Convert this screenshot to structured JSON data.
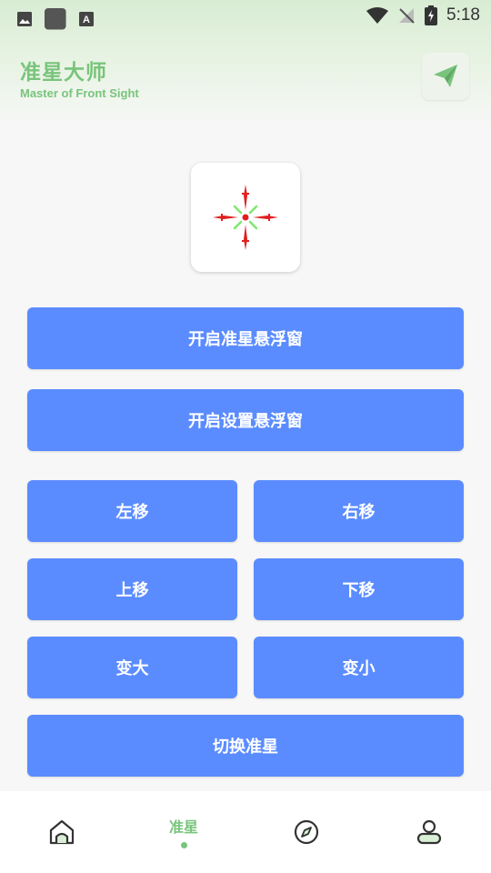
{
  "status_bar": {
    "time": "5:18"
  },
  "header": {
    "title": "准星大师",
    "subtitle": "Master of Front Sight"
  },
  "buttons": {
    "open_crosshair": "开启准星悬浮窗",
    "open_settings": "开启设置悬浮窗",
    "move_left": "左移",
    "move_right": "右移",
    "move_up": "上移",
    "move_down": "下移",
    "bigger": "变大",
    "smaller": "变小",
    "switch_crosshair": "切换准星"
  },
  "bottom_nav": {
    "items": [
      {
        "icon": "home-icon",
        "label": ""
      },
      {
        "icon": "",
        "label": "准星",
        "active": true
      },
      {
        "icon": "compass-icon",
        "label": ""
      },
      {
        "icon": "user-icon",
        "label": ""
      }
    ]
  },
  "colors": {
    "accent_green": "#79c47c",
    "button_blue": "#5b8cff",
    "crosshair_red": "#e02020",
    "crosshair_green": "#7ee86e"
  }
}
